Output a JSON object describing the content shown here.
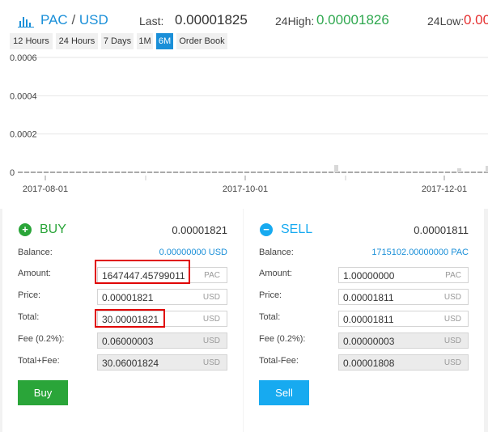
{
  "header": {
    "base": "PAC",
    "slash": "/",
    "quote": "USD",
    "last_label": "Last:",
    "last_value": "0.00001825",
    "high_label": "24High:",
    "high_value": "0.00001826",
    "low_label": "24Low:",
    "low_value": "0.00"
  },
  "tabs": [
    "12 Hours",
    "24 Hours",
    "7 Days",
    "1M",
    "6M",
    "Order Book"
  ],
  "active_tab": "6M",
  "chart_data": {
    "type": "bar",
    "y_ticks": [
      "0.0006",
      "0.0004",
      "0.0002",
      "0"
    ],
    "x_ticks": [
      "2017-08-01",
      "2017-10-01",
      "2017-12-01"
    ],
    "ylim": [
      0,
      0.0006
    ],
    "grid": true,
    "series": [
      {
        "values": [
          1.825e-05,
          1.825e-05,
          1.825e-05
        ]
      }
    ]
  },
  "buy": {
    "title": "BUY",
    "price": "0.00001821",
    "balance_label": "Balance:",
    "balance_value": "0.00000000 USD",
    "amount_label": "Amount:",
    "amount_value": "1647447.45799011",
    "amount_unit": "PAC",
    "price_label": "Price:",
    "price_value": "0.00001821",
    "price_unit": "USD",
    "total_label": "Total:",
    "total_value": "30.00001821",
    "total_unit": "USD",
    "fee_label": "Fee (0.2%):",
    "fee_value": "0.06000003",
    "fee_unit": "USD",
    "totalfee_label": "Total+Fee:",
    "totalfee_value": "30.06001824",
    "totalfee_unit": "USD",
    "button": "Buy"
  },
  "sell": {
    "title": "SELL",
    "price": "0.00001811",
    "balance_label": "Balance:",
    "balance_value": "1715102.00000000 PAC",
    "amount_label": "Amount:",
    "amount_value": "1.00000000",
    "amount_unit": "PAC",
    "price_label": "Price:",
    "price_value": "0.00001811",
    "price_unit": "USD",
    "total_label": "Total:",
    "total_value": "0.00001811",
    "total_unit": "USD",
    "fee_label": "Fee (0.2%):",
    "fee_value": "0.00000003",
    "fee_unit": "USD",
    "totalfee_label": "Total-Fee:",
    "totalfee_value": "0.00001808",
    "totalfee_unit": "USD",
    "button": "Sell"
  },
  "colors": {
    "accent": "#1a8fd8",
    "buy": "#2aa539",
    "sell": "#17aaf0",
    "high": "#2fa84f",
    "low": "#e53030",
    "highlight": "#e00000"
  }
}
